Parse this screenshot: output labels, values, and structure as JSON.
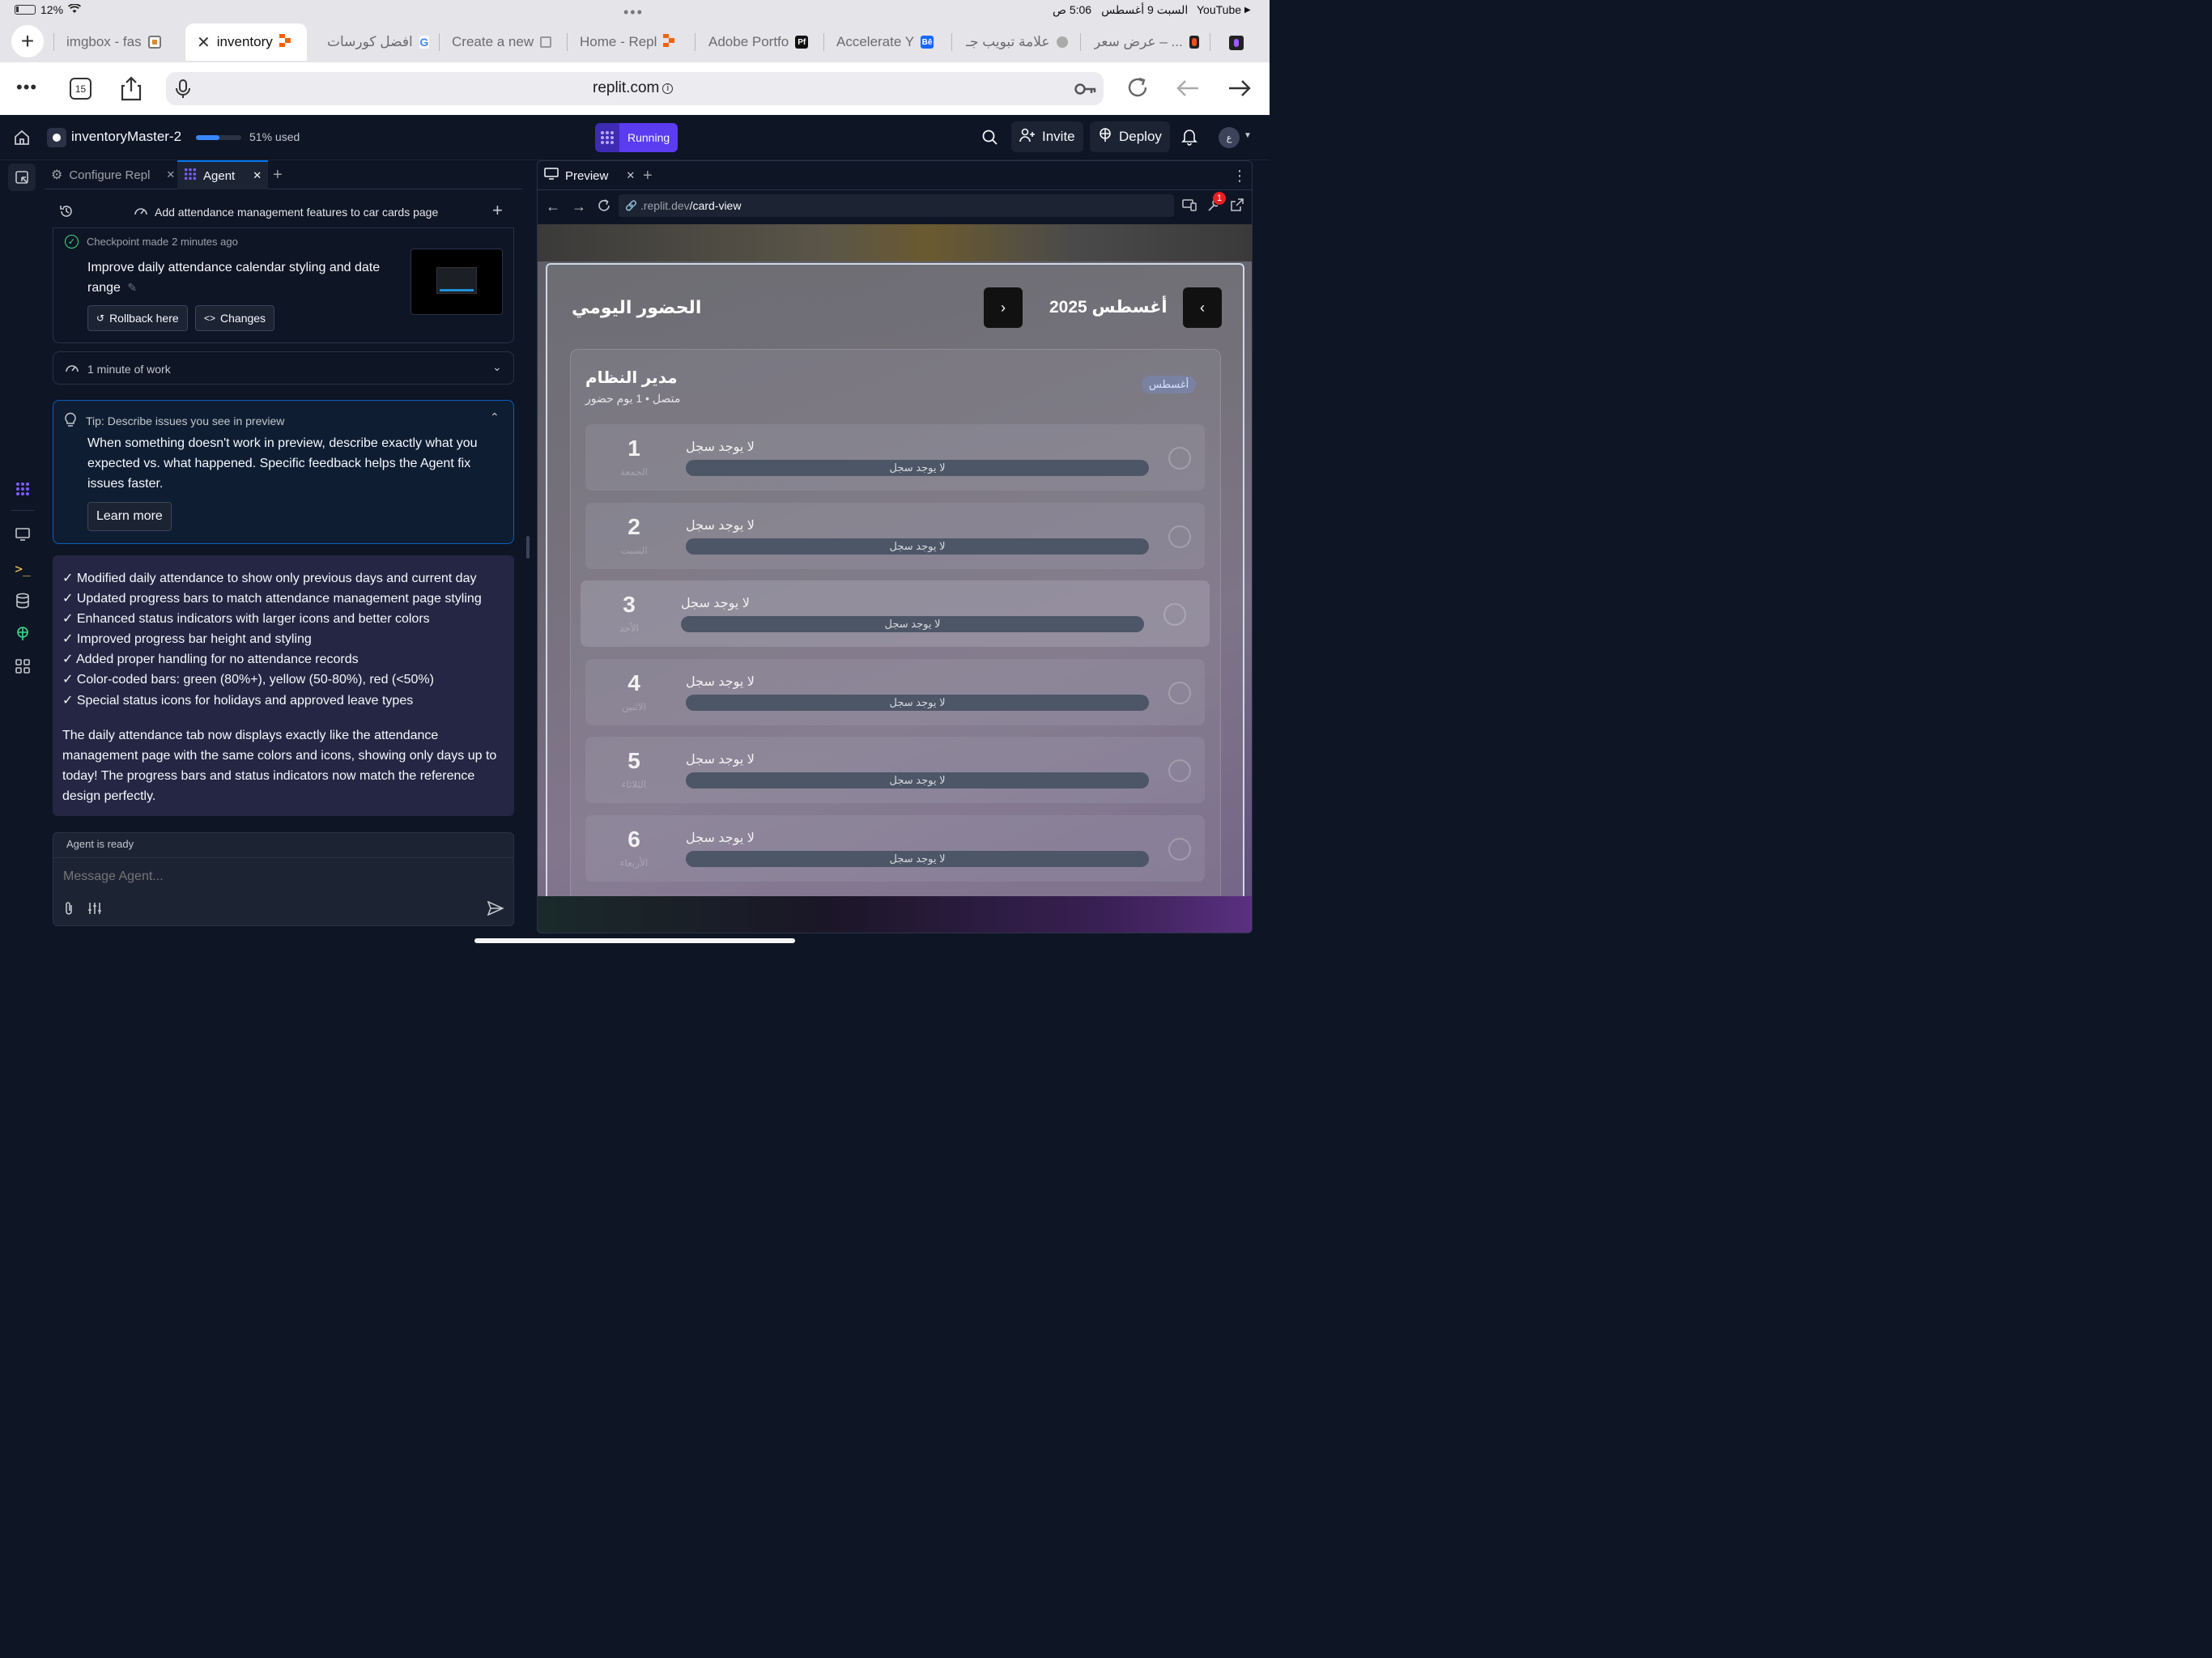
{
  "statusbar": {
    "time": "5:06 ص",
    "date": "السبت 9 أغسطس",
    "back_app": "YouTube",
    "battery": "12%"
  },
  "browser": {
    "tabs": [
      {
        "label": "imgbox - fas",
        "active": false
      },
      {
        "label": "inventory",
        "active": true
      },
      {
        "label": "افضل كورسات",
        "active": false
      },
      {
        "label": "Create a new",
        "active": false
      },
      {
        "label": "Home - Repl",
        "active": false
      },
      {
        "label": "Adobe Portfo",
        "active": false
      },
      {
        "label": "Accelerate Y",
        "active": false
      },
      {
        "label": "علامة تبويب جـ",
        "active": false
      },
      {
        "label": "عرض سعر – ...",
        "active": false
      }
    ],
    "tab_count": "15",
    "url": "replit.com"
  },
  "header": {
    "project_name": "inventoryMaster-2",
    "usage_label": "51% used",
    "usage_fraction": 0.51,
    "run_status": "Running",
    "invite_label": "Invite",
    "deploy_label": "Deploy",
    "avatar_initials": "ع"
  },
  "left": {
    "tabs": [
      {
        "label": "Configure Repl"
      },
      {
        "label": "Agent"
      }
    ],
    "thread_title": "Add attendance management features to car cards page",
    "checkpoint": {
      "prefix": "Checkpoint made",
      "time": "2 minutes ago",
      "message": "Improve daily attendance calendar styling and date range",
      "rollback_label": "Rollback here",
      "changes_label": "Changes"
    },
    "work_summary": "1 minute of work",
    "tip": {
      "title": "Tip: Describe issues you see in preview",
      "body": "When something doesn't work in preview, describe exactly what you expected vs. what happened. Specific feedback helps the Agent fix issues faster.",
      "learn_more": "Learn more"
    },
    "agent_message": {
      "bullets": [
        "✓ Modified daily attendance to show only previous days and current day",
        "✓ Updated progress bars to match attendance management page styling",
        "✓ Enhanced status indicators with larger icons and better colors",
        "✓ Improved progress bar height and styling",
        "✓ Added proper handling for no attendance records",
        "✓ Color-coded bars: green (80%+), yellow (50-80%), red (<50%)",
        "✓ Special status icons for holidays and approved leave types"
      ],
      "summary": "The daily attendance tab now displays exactly like the attendance management page with the same colors and icons, showing only days up to today! The progress bars and status indicators now match the reference design perfectly."
    },
    "status": "Agent is ready",
    "input_placeholder": "Message Agent..."
  },
  "preview": {
    "tab_label": "Preview",
    "url_prefix": ".replit.dev",
    "url_path": "/card-view",
    "badge": "1",
    "page": {
      "title": "الحضور اليومي",
      "month_label": "أغسطس 2025",
      "card_name": "مدير النظام",
      "card_sub": "متصل • 1 يوم حضور",
      "card_badge": "أغسطس",
      "no_record": "لا يوجد سجل",
      "days": [
        {
          "num": "1",
          "weekday": "الجمعة"
        },
        {
          "num": "2",
          "weekday": "السبت"
        },
        {
          "num": "3",
          "weekday": "الأحد"
        },
        {
          "num": "4",
          "weekday": "الاثنين"
        },
        {
          "num": "5",
          "weekday": "الثلاثاء"
        },
        {
          "num": "6",
          "weekday": "الأربعاء"
        }
      ]
    }
  }
}
